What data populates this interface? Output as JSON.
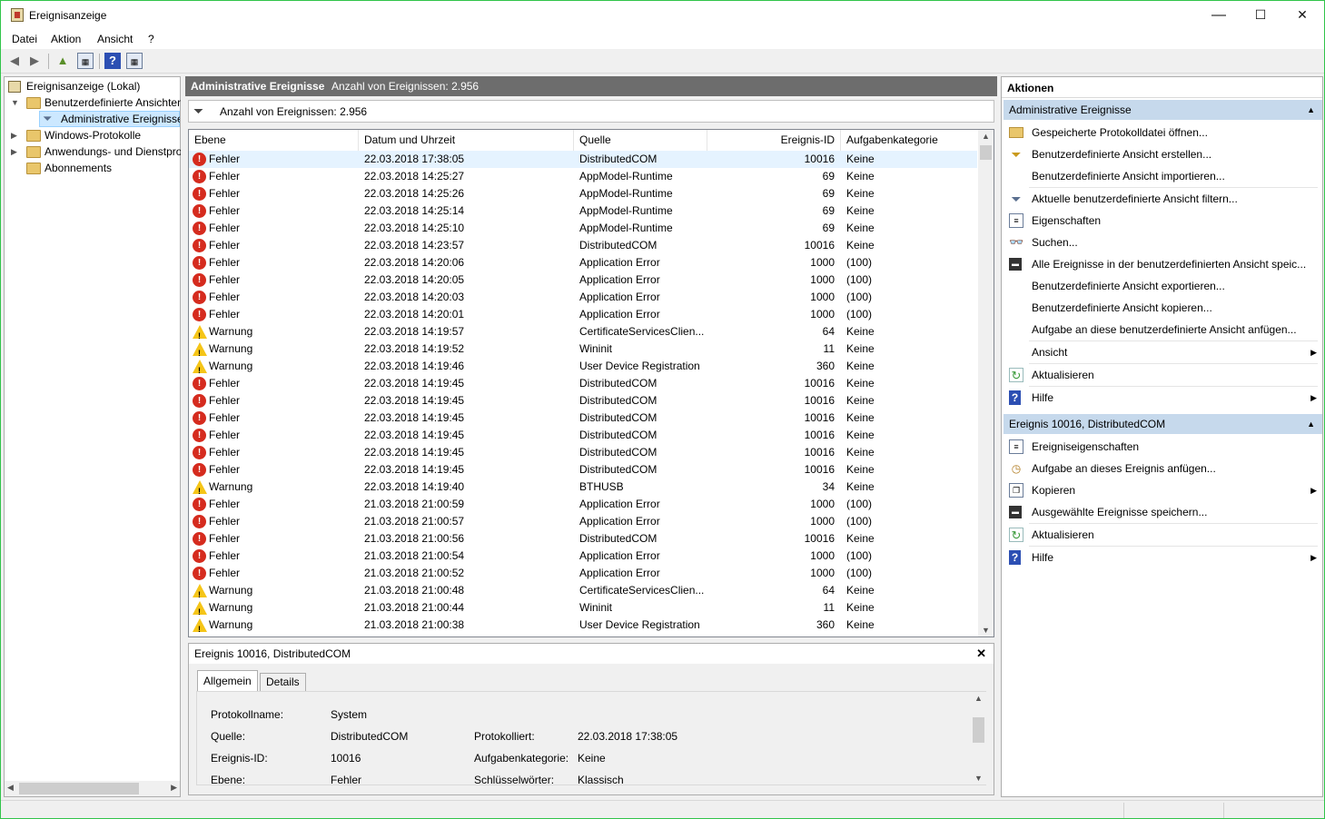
{
  "window": {
    "title": "Ereignisanzeige",
    "minimize": "—",
    "maximize": "☐",
    "close": "✕"
  },
  "menu": [
    "Datei",
    "Aktion",
    "Ansicht",
    "?"
  ],
  "tree": {
    "root": "Ereignisanzeige (Lokal)",
    "custom_views": "Benutzerdefinierte Ansichten",
    "admin_events": "Administrative Ereignisse",
    "windows_logs": "Windows-Protokolle",
    "app_logs": "Anwendungs- und Dienstprotokolle",
    "subscriptions": "Abonnements"
  },
  "center": {
    "title": "Administrative Ereignisse",
    "count": "Anzahl von Ereignissen: 2.956",
    "filter_count": "Anzahl von Ereignissen: 2.956"
  },
  "columns": [
    "Ebene",
    "Datum und Uhrzeit",
    "Quelle",
    "Ereignis-ID",
    "Aufgabenkategorie"
  ],
  "events": [
    [
      "Fehler",
      "22.03.2018 17:38:05",
      "DistributedCOM",
      "10016",
      "Keine"
    ],
    [
      "Fehler",
      "22.03.2018 14:25:27",
      "AppModel-Runtime",
      "69",
      "Keine"
    ],
    [
      "Fehler",
      "22.03.2018 14:25:26",
      "AppModel-Runtime",
      "69",
      "Keine"
    ],
    [
      "Fehler",
      "22.03.2018 14:25:14",
      "AppModel-Runtime",
      "69",
      "Keine"
    ],
    [
      "Fehler",
      "22.03.2018 14:25:10",
      "AppModel-Runtime",
      "69",
      "Keine"
    ],
    [
      "Fehler",
      "22.03.2018 14:23:57",
      "DistributedCOM",
      "10016",
      "Keine"
    ],
    [
      "Fehler",
      "22.03.2018 14:20:06",
      "Application Error",
      "1000",
      "(100)"
    ],
    [
      "Fehler",
      "22.03.2018 14:20:05",
      "Application Error",
      "1000",
      "(100)"
    ],
    [
      "Fehler",
      "22.03.2018 14:20:03",
      "Application Error",
      "1000",
      "(100)"
    ],
    [
      "Fehler",
      "22.03.2018 14:20:01",
      "Application Error",
      "1000",
      "(100)"
    ],
    [
      "Warnung",
      "22.03.2018 14:19:57",
      "CertificateServicesClien...",
      "64",
      "Keine"
    ],
    [
      "Warnung",
      "22.03.2018 14:19:52",
      "Wininit",
      "11",
      "Keine"
    ],
    [
      "Warnung",
      "22.03.2018 14:19:46",
      "User Device Registration",
      "360",
      "Keine"
    ],
    [
      "Fehler",
      "22.03.2018 14:19:45",
      "DistributedCOM",
      "10016",
      "Keine"
    ],
    [
      "Fehler",
      "22.03.2018 14:19:45",
      "DistributedCOM",
      "10016",
      "Keine"
    ],
    [
      "Fehler",
      "22.03.2018 14:19:45",
      "DistributedCOM",
      "10016",
      "Keine"
    ],
    [
      "Fehler",
      "22.03.2018 14:19:45",
      "DistributedCOM",
      "10016",
      "Keine"
    ],
    [
      "Fehler",
      "22.03.2018 14:19:45",
      "DistributedCOM",
      "10016",
      "Keine"
    ],
    [
      "Fehler",
      "22.03.2018 14:19:45",
      "DistributedCOM",
      "10016",
      "Keine"
    ],
    [
      "Warnung",
      "22.03.2018 14:19:40",
      "BTHUSB",
      "34",
      "Keine"
    ],
    [
      "Fehler",
      "21.03.2018 21:00:59",
      "Application Error",
      "1000",
      "(100)"
    ],
    [
      "Fehler",
      "21.03.2018 21:00:57",
      "Application Error",
      "1000",
      "(100)"
    ],
    [
      "Fehler",
      "21.03.2018 21:00:56",
      "DistributedCOM",
      "10016",
      "Keine"
    ],
    [
      "Fehler",
      "21.03.2018 21:00:54",
      "Application Error",
      "1000",
      "(100)"
    ],
    [
      "Fehler",
      "21.03.2018 21:00:52",
      "Application Error",
      "1000",
      "(100)"
    ],
    [
      "Warnung",
      "21.03.2018 21:00:48",
      "CertificateServicesClien...",
      "64",
      "Keine"
    ],
    [
      "Warnung",
      "21.03.2018 21:00:44",
      "Wininit",
      "11",
      "Keine"
    ],
    [
      "Warnung",
      "21.03.2018 21:00:38",
      "User Device Registration",
      "360",
      "Keine"
    ]
  ],
  "detail": {
    "title": "Ereignis 10016, DistributedCOM",
    "tab_general": "Allgemein",
    "tab_details": "Details",
    "log_name_label": "Protokollname:",
    "log_name": "System",
    "source_label": "Quelle:",
    "source": "DistributedCOM",
    "logged_label": "Protokolliert:",
    "logged": "22.03.2018 17:38:05",
    "event_id_label": "Ereignis-ID:",
    "event_id": "10016",
    "task_label": "Aufgabenkategorie:",
    "task": "Keine",
    "level_label": "Ebene:",
    "level": "Fehler",
    "keywords_label": "Schlüsselwörter:",
    "keywords": "Klassisch"
  },
  "actions": {
    "header": "Aktionen",
    "section1": "Administrative Ereignisse",
    "items1": [
      "Gespeicherte Protokolldatei öffnen...",
      "Benutzerdefinierte Ansicht erstellen...",
      "Benutzerdefinierte Ansicht importieren...",
      "Aktuelle benutzerdefinierte Ansicht filtern...",
      "Eigenschaften",
      "Suchen...",
      "Alle Ereignisse in der benutzerdefinierten Ansicht speic...",
      "Benutzerdefinierte Ansicht exportieren...",
      "Benutzerdefinierte Ansicht kopieren...",
      "Aufgabe an diese benutzerdefinierte Ansicht anfügen...",
      "Ansicht",
      "Aktualisieren",
      "Hilfe"
    ],
    "section2": "Ereignis 10016, DistributedCOM",
    "items2": [
      "Ereigniseigenschaften",
      "Aufgabe an dieses Ereignis anfügen...",
      "Kopieren",
      "Ausgewählte Ereignisse speichern...",
      "Aktualisieren",
      "Hilfe"
    ]
  },
  "colors": {
    "accent": "#c6d9ec",
    "header_bar": "#6d6d6d",
    "error": "#d52b1e",
    "warning": "#f5c518",
    "selected_row": "#e5f3ff"
  }
}
